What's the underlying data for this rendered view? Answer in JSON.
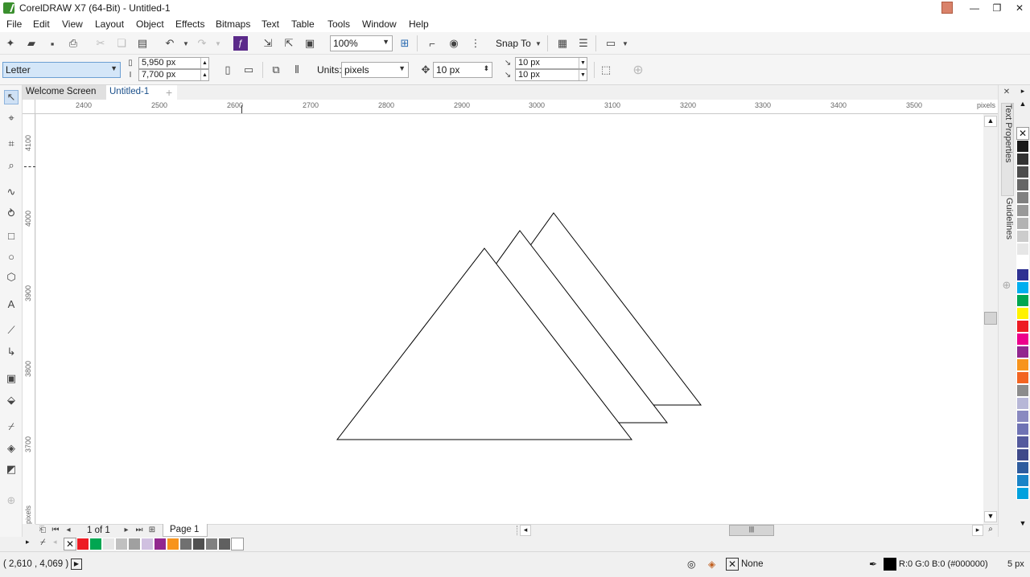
{
  "window": {
    "title": "CorelDRAW X7 (64-Bit) - Untitled-1",
    "minimize_glyph": "—",
    "restore_glyph": "❐",
    "close_glyph": "✕"
  },
  "menu": [
    "File",
    "Edit",
    "View",
    "Layout",
    "Object",
    "Effects",
    "Bitmaps",
    "Text",
    "Table",
    "Tools",
    "Window",
    "Help"
  ],
  "standard_toolbar": {
    "zoom_value": "100%",
    "snap_to_label": "Snap To"
  },
  "property_bar": {
    "page_size": "Letter",
    "width": "5,950 px",
    "height": "7,700 px",
    "units_label": "Units:",
    "units_value": "pixels",
    "nudge": "10 px",
    "dup_x": "10 px",
    "dup_y": "10 px"
  },
  "doc_tabs": {
    "welcome": "Welcome Screen",
    "active": "Untitled-1",
    "add": "+"
  },
  "ruler": {
    "h_labels": [
      "2400",
      "2500",
      "2600",
      "2700",
      "2800",
      "2900",
      "3000",
      "3100",
      "3200",
      "3300",
      "3400",
      "3500"
    ],
    "h_unit": "pixels",
    "v_labels": [
      "4100",
      "4000",
      "3900",
      "3800",
      "3700"
    ],
    "v_unit": "pixels"
  },
  "dockers": {
    "text_properties": "Text Properties",
    "guidelines": "Guidelines"
  },
  "page_nav": {
    "page_count": "1 of 1",
    "page_tab": "Page 1"
  },
  "status": {
    "coords": "( 2,610 , 4,069 )",
    "fill_label": "None",
    "outline_color": "R:0 G:0 B:0 (#000000)",
    "outline_width": "5 px"
  },
  "colors": {
    "vertical_palette": [
      "#1a1a1a",
      "#333333",
      "#4d4d4d",
      "#666666",
      "#808080",
      "#999999",
      "#b3b3b3",
      "#cccccc",
      "#e6e6e6",
      "#ffffff",
      "#2e3192",
      "#00aeef",
      "#00a651",
      "#fff200",
      "#ed1c24",
      "#ec008c",
      "#92278f",
      "#f7941d",
      "#f26522",
      "#8c8c8c",
      "#b7b7d7",
      "#8989c0",
      "#6f73b4",
      "#545a9d",
      "#3f4a8a",
      "#2e5c9e",
      "#1a84c7",
      "#00a1de"
    ],
    "doc_palette": [
      "#ed1c24",
      "#00a651",
      "#e6e6e6",
      "#c0c0c0",
      "#a0a0a0",
      "#d0c0e0",
      "#92278f",
      "#f7941d",
      "#707070",
      "#505050",
      "#808080",
      "#606060",
      "#ffffff"
    ]
  }
}
